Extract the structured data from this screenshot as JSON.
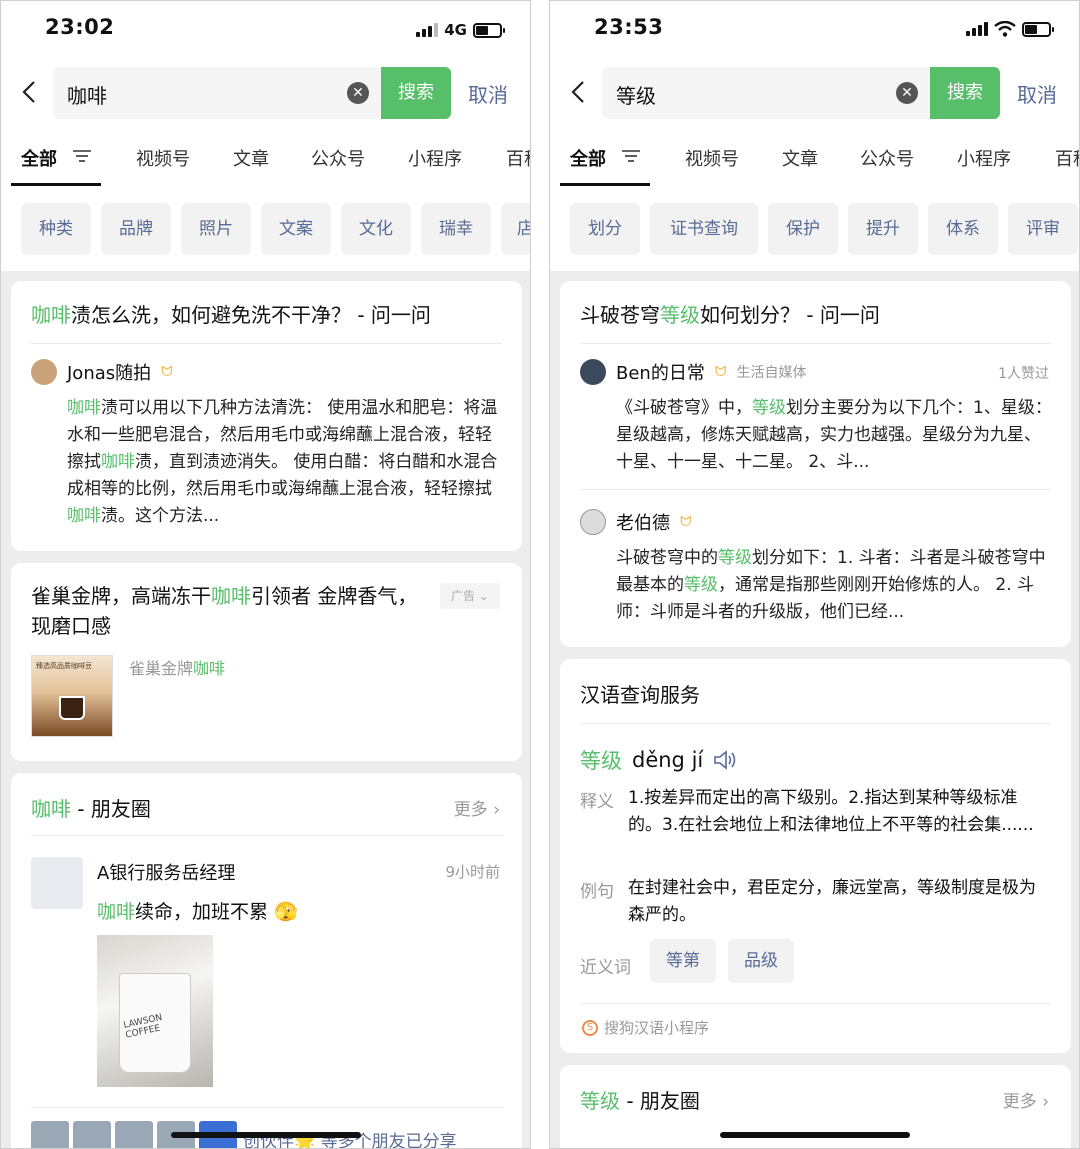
{
  "left": {
    "status": {
      "time": "23:02",
      "network": "4G"
    },
    "search": {
      "query": "咖啡",
      "search_btn": "搜索",
      "cancel": "取消"
    },
    "tabs": [
      "全部",
      "视频号",
      "文章",
      "公众号",
      "小程序",
      "百科"
    ],
    "chips": [
      "种类",
      "品牌",
      "照片",
      "文案",
      "文化",
      "瑞幸",
      "店"
    ],
    "card1": {
      "title_hl": "咖啡",
      "title_rest": "渍怎么洗，如何避免洗不干净？ - 问一问",
      "author": "Jonas随拍",
      "body": [
        {
          "t": "咖啡",
          "h": true
        },
        {
          "t": "渍可以用以下几种方法清洗：  使用温水和肥皂：将温水和一些肥皂混合，然后用毛巾或海绵蘸上混合液，轻轻擦拭",
          "h": false
        },
        {
          "t": "咖啡",
          "h": true
        },
        {
          "t": "渍，直到渍迹消失。  使用白醋：将白醋和水混合成相等的比例，然后用毛巾或海绵蘸上混合液，轻轻擦拭",
          "h": false
        },
        {
          "t": "咖啡",
          "h": true
        },
        {
          "t": "渍。这个方法...",
          "h": false
        }
      ]
    },
    "card2": {
      "title_a": "雀巢金牌，高端冻干",
      "title_hl": "咖啡",
      "title_b": "引领者 金牌香气，现磨口感",
      "ad_tag": "广告",
      "brand_a": "雀巢金牌",
      "brand_hl": "咖啡",
      "img_caption": "臻选高品质咖啡豆"
    },
    "card3": {
      "title_hl": "咖啡",
      "title_rest": " - 朋友圈",
      "more": "更多",
      "poster": "A银行服务岳经理",
      "time": "9小时前",
      "text_hl": "咖啡",
      "text_rest": "续命，加班不累",
      "cup_text": "LAWSON COFFEE",
      "footer": "创伙伴🌟 等多个朋友已分享"
    }
  },
  "right": {
    "status": {
      "time": "23:53"
    },
    "search": {
      "query": "等级",
      "search_btn": "搜索",
      "cancel": "取消"
    },
    "tabs": [
      "全部",
      "视频号",
      "文章",
      "公众号",
      "小程序",
      "百科"
    ],
    "chips": [
      "划分",
      "证书查询",
      "保护",
      "提升",
      "体系",
      "评审"
    ],
    "card1": {
      "title_a": "斗破苍穹",
      "title_hl": "等级",
      "title_b": "如何划分？ - 问一问",
      "a1": {
        "name": "Ben的日常",
        "tag": "生活自媒体",
        "likes": "1人赞过"
      },
      "a1_body": [
        {
          "t": "《斗破苍穹》中，",
          "h": false
        },
        {
          "t": "等级",
          "h": true
        },
        {
          "t": "划分主要分为以下几个：1、星级：星级越高，修炼天赋越高，实力也越强。星级分为九星、十星、十一星、十二星。 2、斗...",
          "h": false
        }
      ],
      "a2": {
        "name": "老伯德"
      },
      "a2_body": [
        {
          "t": "斗破苍穹中的",
          "h": false
        },
        {
          "t": "等级",
          "h": true
        },
        {
          "t": "划分如下：1. 斗者：斗者是斗破苍穹中最基本的",
          "h": false
        },
        {
          "t": "等级",
          "h": true
        },
        {
          "t": "，通常是指那些刚刚开始修炼的人。 2. 斗师：斗师是斗者的升级版，他们已经...",
          "h": false
        }
      ]
    },
    "card2": {
      "header": "汉语查询服务",
      "word": "等级",
      "pinyin": "děng jí",
      "def_label": "释义",
      "def": "1.按差异而定出的高下级别。2.指达到某种等级标准的。3.在社会地位上和法律地位上不平等的社会集......",
      "ex_label": "例句",
      "ex": "在封建社会中，君臣定分，廉远堂高，等级制度是极为森严的。",
      "syn_label": "近义词",
      "syn": [
        "等第",
        "品级"
      ],
      "source": "搜狗汉语小程序"
    },
    "card3": {
      "title_hl": "等级",
      "title_rest": " - 朋友圈",
      "more": "更多"
    }
  }
}
